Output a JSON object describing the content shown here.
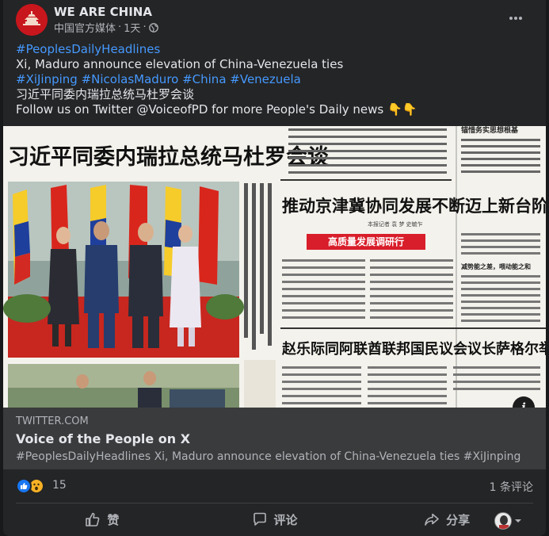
{
  "post": {
    "author": "WE ARE CHINA",
    "subtitle": "中国官方媒体",
    "separator": "·",
    "time": "1天",
    "lines": [
      {
        "text": "#PeoplesDailyHeadlines",
        "hashtag": true
      },
      {
        "text": "Xi, Maduro announce elevation of China-Venezuela ties",
        "hashtag": false
      },
      {
        "text": "#XiJinping #NicolasMaduro #China #Venezuela",
        "hashtag": true
      },
      {
        "text": "习近平同委内瑞拉总统马杜罗会谈",
        "hashtag": false
      },
      {
        "text": "Follow us on Twitter @VoiceofPD for more People's Daily news 👇👇",
        "hashtag": false
      }
    ]
  },
  "newspaper": {
    "headline_main": "习近平同委内瑞拉总统马杜罗会谈",
    "headline_right": "推动京津冀协同发展不断迈上新台阶",
    "banner": "高质量发展调研行",
    "headline_bottom": "赵乐际同阿联酋联邦国民议会议长萨格尔举行会谈",
    "top_right": "锚惜务实思想根基",
    "side_note": "减势能之差，喂动能之和",
    "byline": "本报记者  袁  梦  史毓乍"
  },
  "link": {
    "domain": "TWITTER.COM",
    "title": "Voice of the People on X",
    "description": "#PeoplesDailyHeadlines Xi, Maduro announce elevation of China-Venezuela ties #XiJinping …"
  },
  "reactions": {
    "count": "15",
    "comments": "1 条评论"
  },
  "actions": {
    "like": "赞",
    "comment": "评论",
    "share": "分享"
  },
  "colors": {
    "background": "#242526",
    "hashtag": "#4599ff",
    "banner_red": "#d81e2a"
  }
}
